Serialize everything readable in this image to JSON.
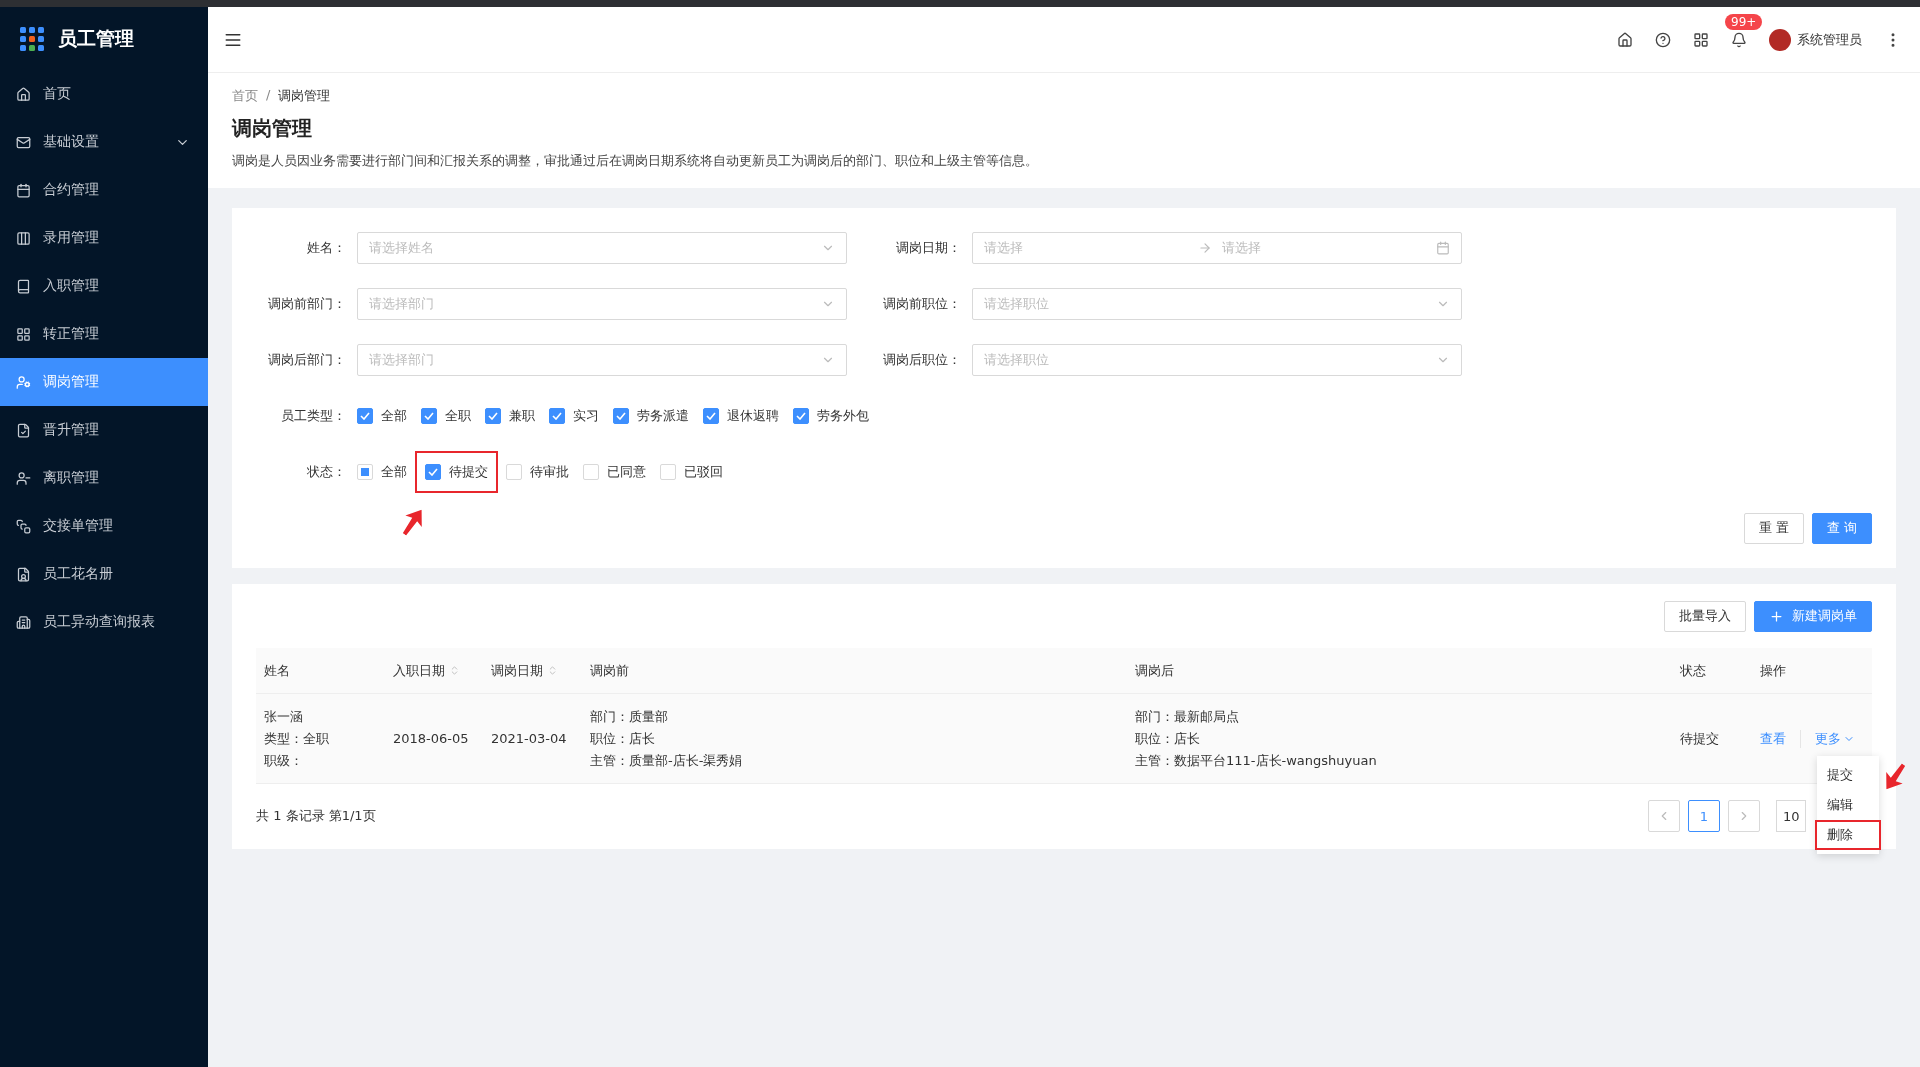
{
  "app": {
    "title": "员工管理"
  },
  "sidebar": {
    "items": [
      {
        "label": "首页",
        "kind": "item",
        "selected": false
      },
      {
        "label": "基础设置",
        "kind": "submenu",
        "expanded": false,
        "selected": false
      },
      {
        "label": "合约管理",
        "kind": "item",
        "selected": false
      },
      {
        "label": "录用管理",
        "kind": "item",
        "selected": false
      },
      {
        "label": "入职管理",
        "kind": "item",
        "selected": false
      },
      {
        "label": "转正管理",
        "kind": "item",
        "selected": false
      },
      {
        "label": "调岗管理",
        "kind": "item",
        "selected": true
      },
      {
        "label": "晋升管理",
        "kind": "item",
        "selected": false
      },
      {
        "label": "离职管理",
        "kind": "item",
        "selected": false
      },
      {
        "label": "交接单管理",
        "kind": "item",
        "selected": false
      },
      {
        "label": "员工花名册",
        "kind": "item",
        "selected": false
      },
      {
        "label": "员工异动查询报表",
        "kind": "item",
        "selected": false
      }
    ]
  },
  "header": {
    "notifications": "99+",
    "user": "系统管理员"
  },
  "page": {
    "breadcrumb": [
      "首页",
      "调岗管理"
    ],
    "breadcrumb_separator": "/",
    "title": "调岗管理",
    "description": "调岗是人员因业务需要进行部门间和汇报关系的调整，审批通过后在调岗日期系统将自动更新员工为调岗后的部门、职位和上级主管等信息。"
  },
  "filters": {
    "fields": [
      {
        "label": "姓名：",
        "kind": "select",
        "placeholder": "请选择姓名"
      },
      {
        "label": "调岗日期：",
        "kind": "date_range",
        "placeholder": "请选择",
        "placeholder_end": "请选择"
      },
      {
        "label": "调岗前部门：",
        "kind": "select",
        "placeholder": "请选择部门"
      },
      {
        "label": "调岗前职位：",
        "kind": "select",
        "placeholder": "请选择职位"
      },
      {
        "label": "调岗后部门：",
        "kind": "select",
        "placeholder": "请选择部门"
      },
      {
        "label": "调岗后职位：",
        "kind": "select",
        "placeholder": "请选择职位"
      }
    ],
    "employee_type": {
      "label": "员工类型：",
      "options": [
        {
          "label": "全部",
          "checked": true,
          "highlighted": false
        },
        {
          "label": "全职",
          "checked": true,
          "highlighted": false
        },
        {
          "label": "兼职",
          "checked": true,
          "highlighted": false
        },
        {
          "label": "实习",
          "checked": true,
          "highlighted": false
        },
        {
          "label": "劳务派遣",
          "checked": true,
          "highlighted": false
        },
        {
          "label": "退休返聘",
          "checked": true,
          "highlighted": false
        },
        {
          "label": "劳务外包",
          "checked": true,
          "highlighted": false
        }
      ]
    },
    "status": {
      "label": "状态：",
      "options": [
        {
          "label": "全部",
          "checked": false,
          "indeterminate": true,
          "highlighted": false
        },
        {
          "label": "待提交",
          "checked": true,
          "highlighted": true
        },
        {
          "label": "待审批",
          "checked": false,
          "highlighted": false
        },
        {
          "label": "已同意",
          "checked": false,
          "highlighted": false
        },
        {
          "label": "已驳回",
          "checked": false,
          "highlighted": false
        }
      ]
    },
    "reset": "重 置",
    "query": "查 询"
  },
  "table": {
    "toolbar": {
      "import": "批量导入",
      "create": "新建调岗单"
    },
    "columns": [
      {
        "label": "姓名",
        "sortable": false
      },
      {
        "label": "入职日期",
        "sortable": true
      },
      {
        "label": "调岗日期",
        "sortable": true
      },
      {
        "label": "调岗前",
        "sortable": false
      },
      {
        "label": "调岗后",
        "sortable": false
      },
      {
        "label": "状态",
        "sortable": false
      },
      {
        "label": "操作",
        "sortable": false
      }
    ],
    "rows": [
      {
        "name": [
          "张一涵",
          "类型：全职",
          "职级："
        ],
        "hire_date": "2018-06-05",
        "transfer_date": "2021-03-04",
        "before": [
          "部门：质量部",
          "职位：店长",
          "主管：质量部-店长-渠秀娟"
        ],
        "after": [
          "部门：最新邮局点",
          "职位：店长",
          "主管：数据平台111-店长-wangshuyuan"
        ],
        "status": "待提交",
        "view": "查看",
        "more": "更多",
        "menu": {
          "open": true,
          "items": [
            {
              "label": "提交",
              "highlighted": false
            },
            {
              "label": "编辑",
              "highlighted": false
            },
            {
              "label": "删除",
              "highlighted": true
            }
          ]
        }
      }
    ]
  },
  "pagination": {
    "summary": "共 1 条记录 第1/1页",
    "pages": [
      {
        "label": "1",
        "selected": true
      }
    ],
    "page_size": "10"
  }
}
